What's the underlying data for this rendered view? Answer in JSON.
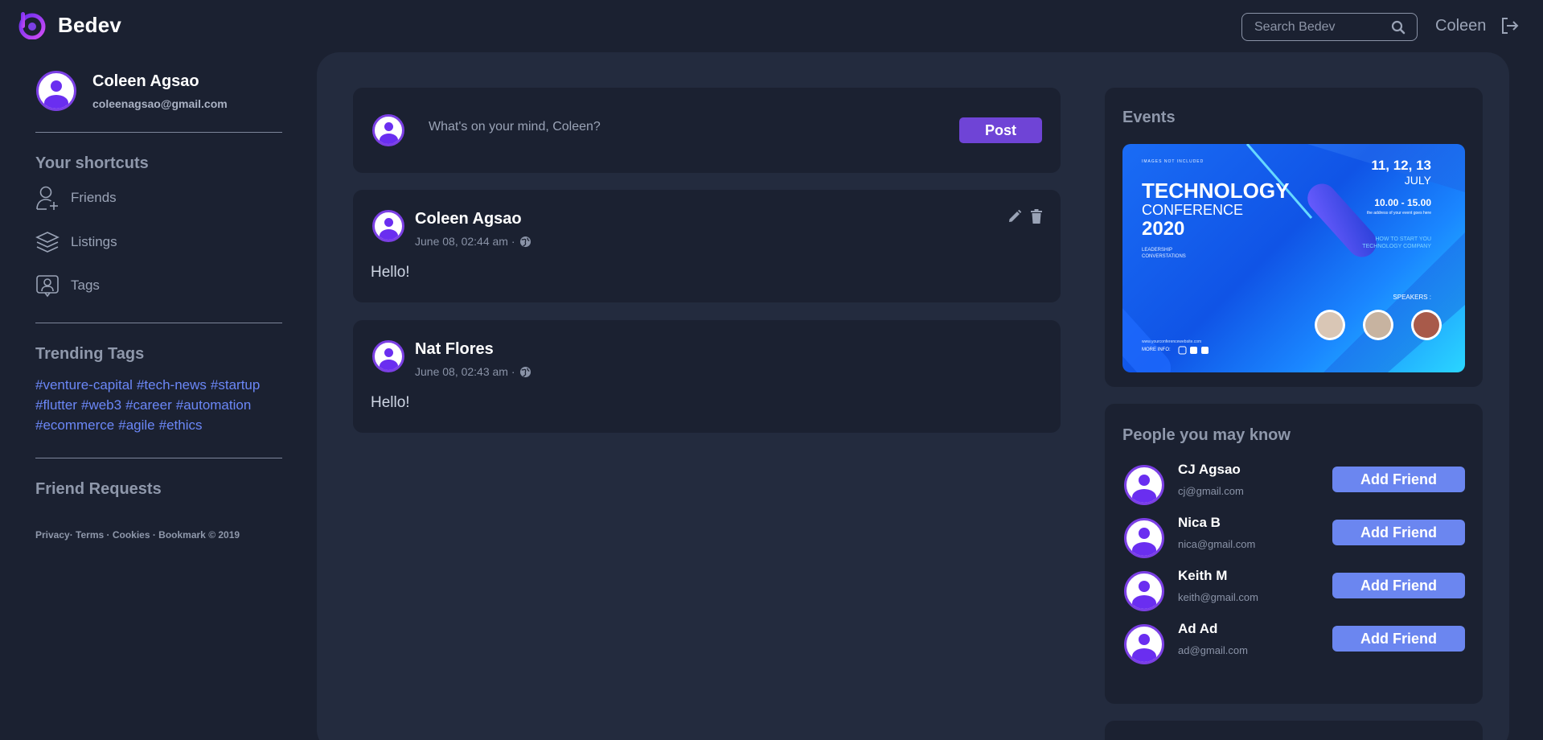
{
  "app": {
    "name": "Bedev"
  },
  "header": {
    "search_placeholder": "Search Bedev",
    "username": "Coleen"
  },
  "profile": {
    "name": "Coleen Agsao",
    "email": "coleenagsao@gmail.com"
  },
  "shortcuts": {
    "title": "Your shortcuts",
    "items": [
      {
        "label": "Friends",
        "icon": "add-user-icon"
      },
      {
        "label": "Listings",
        "icon": "layers-icon"
      },
      {
        "label": "Tags",
        "icon": "tag-person-icon"
      }
    ]
  },
  "trending": {
    "title": "Trending Tags",
    "tags": [
      "#venture-capital",
      "#tech-news",
      "#startup",
      "#flutter",
      "#web3",
      "#career",
      "#automation",
      "#ecommerce",
      "#agile",
      "#ethics"
    ]
  },
  "friend_requests": {
    "title": "Friend Requests"
  },
  "footer": {
    "links": "Privacy· Terms · Cookies · Bookmark © 2019"
  },
  "composer": {
    "placeholder": "What's on your mind, Coleen?",
    "post_label": "Post"
  },
  "posts": [
    {
      "author": "Coleen Agsao",
      "date": "June 08, 02:44 am ·",
      "content": "Hello!",
      "editable": true
    },
    {
      "author": "Nat Flores",
      "date": "June 08, 02:43 am ·",
      "content": "Hello!",
      "editable": false
    }
  ],
  "events": {
    "title": "Events",
    "poster": {
      "tag": "IMAGES NOT INCLUDED",
      "headline": "TECHNOLOGY",
      "sub": "CONFERENCE",
      "year": "2020",
      "topic": "LEADERSHIP CONVERSTATIONS",
      "dates": "11, 12, 13",
      "month": "JULY",
      "time": "10.00 - 15.00",
      "address": "the address of your event goes here",
      "how": "HOW TO START YOU TECHNOLOGY COMPANY",
      "speakers": "SPEAKERS :",
      "more": "MORE INFO:",
      "website": "www.yourconferencewebsite.com"
    }
  },
  "people": {
    "title": "People you may know",
    "add_label": "Add Friend",
    "items": [
      {
        "name": "CJ Agsao",
        "email": "cj@gmail.com"
      },
      {
        "name": "Nica B",
        "email": "nica@gmail.com"
      },
      {
        "name": "Keith M",
        "email": "keith@gmail.com"
      },
      {
        "name": "Ad Ad",
        "email": "ad@gmail.com"
      }
    ]
  },
  "colors": {
    "background": "#1b2131",
    "panel": "#232b3e",
    "accent_purple": "#6f44d6",
    "accent_blue": "#6b86f0",
    "tag_link": "#6b87f7"
  }
}
